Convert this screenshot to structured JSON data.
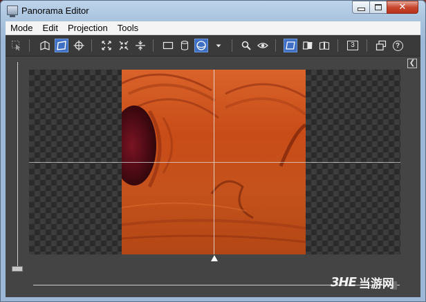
{
  "window": {
    "title": "Panorama Editor"
  },
  "menu": [
    {
      "id": "mode",
      "label": "Mode"
    },
    {
      "id": "edit",
      "label": "Edit"
    },
    {
      "id": "projection",
      "label": "Projection"
    },
    {
      "id": "tools",
      "label": "Tools"
    }
  ],
  "toolbar": {
    "items": [
      {
        "icon": "select-arrow-icon",
        "active": false
      },
      {
        "icon": "cube-face-icon",
        "active": false
      },
      {
        "icon": "perspective-plane-icon",
        "active": true
      },
      {
        "icon": "crosshair-target-icon",
        "active": false
      },
      {
        "icon": "expand-icon",
        "active": false
      },
      {
        "icon": "collapse-icon",
        "active": false
      },
      {
        "icon": "vertical-center-icon",
        "active": false
      },
      {
        "icon": "rectangle-projection-icon",
        "active": false
      },
      {
        "icon": "cylinder-projection-icon",
        "active": false
      },
      {
        "icon": "sphere-projection-icon",
        "active": true
      },
      {
        "icon": "dropdown-arrow-icon",
        "active": false
      },
      {
        "icon": "zoom-icon",
        "active": false
      },
      {
        "icon": "eye-preview-icon",
        "active": false
      },
      {
        "icon": "plane-view-icon",
        "active": true
      },
      {
        "icon": "split-view-icon",
        "active": false
      },
      {
        "icon": "page-view-icon",
        "active": false
      },
      {
        "icon": "number-three-icon",
        "active": false,
        "label": "3"
      },
      {
        "icon": "window-stack-icon",
        "active": false
      },
      {
        "icon": "help-icon",
        "active": false,
        "label": "?"
      }
    ]
  },
  "colors": {
    "active_button": "#3f6fc4",
    "panorama_orange": "#d1501c",
    "window_frame": "#a9c3de",
    "workspace_bg": "#444444"
  },
  "watermark": {
    "logo": "3HE",
    "text": "当游网"
  }
}
